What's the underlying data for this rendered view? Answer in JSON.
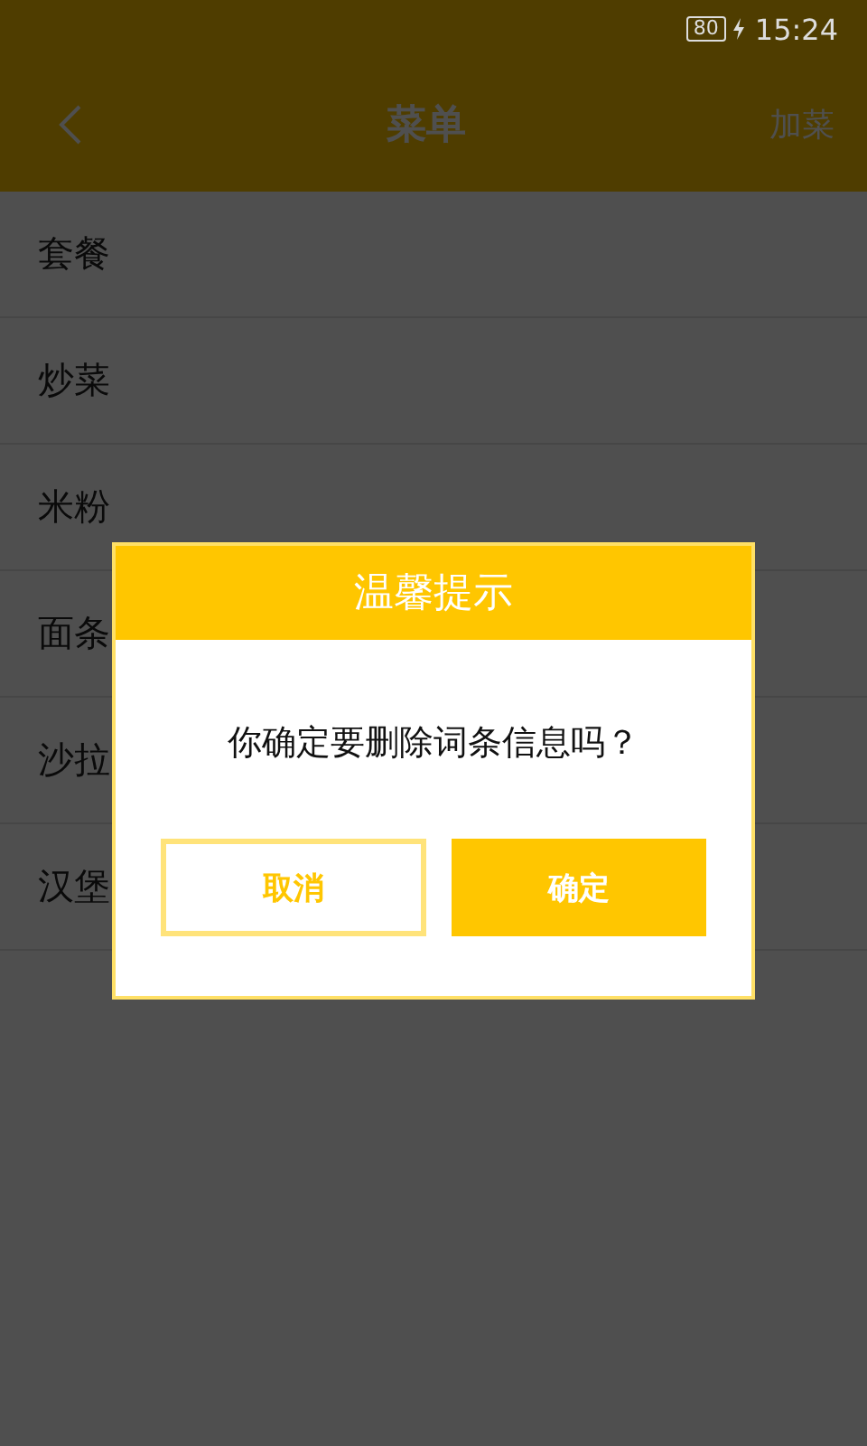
{
  "status_bar": {
    "battery": "80",
    "time": "15:24"
  },
  "header": {
    "title": "菜单",
    "action": "加菜"
  },
  "menu_items": [
    {
      "label": "套餐"
    },
    {
      "label": "炒菜"
    },
    {
      "label": "米粉"
    },
    {
      "label": "面条"
    },
    {
      "label": "沙拉"
    },
    {
      "label": "汉堡"
    }
  ],
  "dialog": {
    "title": "温馨提示",
    "message": "你确定要删除词条信息吗？",
    "buttons": [
      {
        "label": "取消",
        "kind": "outline"
      },
      {
        "label": "确定",
        "kind": "filled"
      }
    ]
  }
}
